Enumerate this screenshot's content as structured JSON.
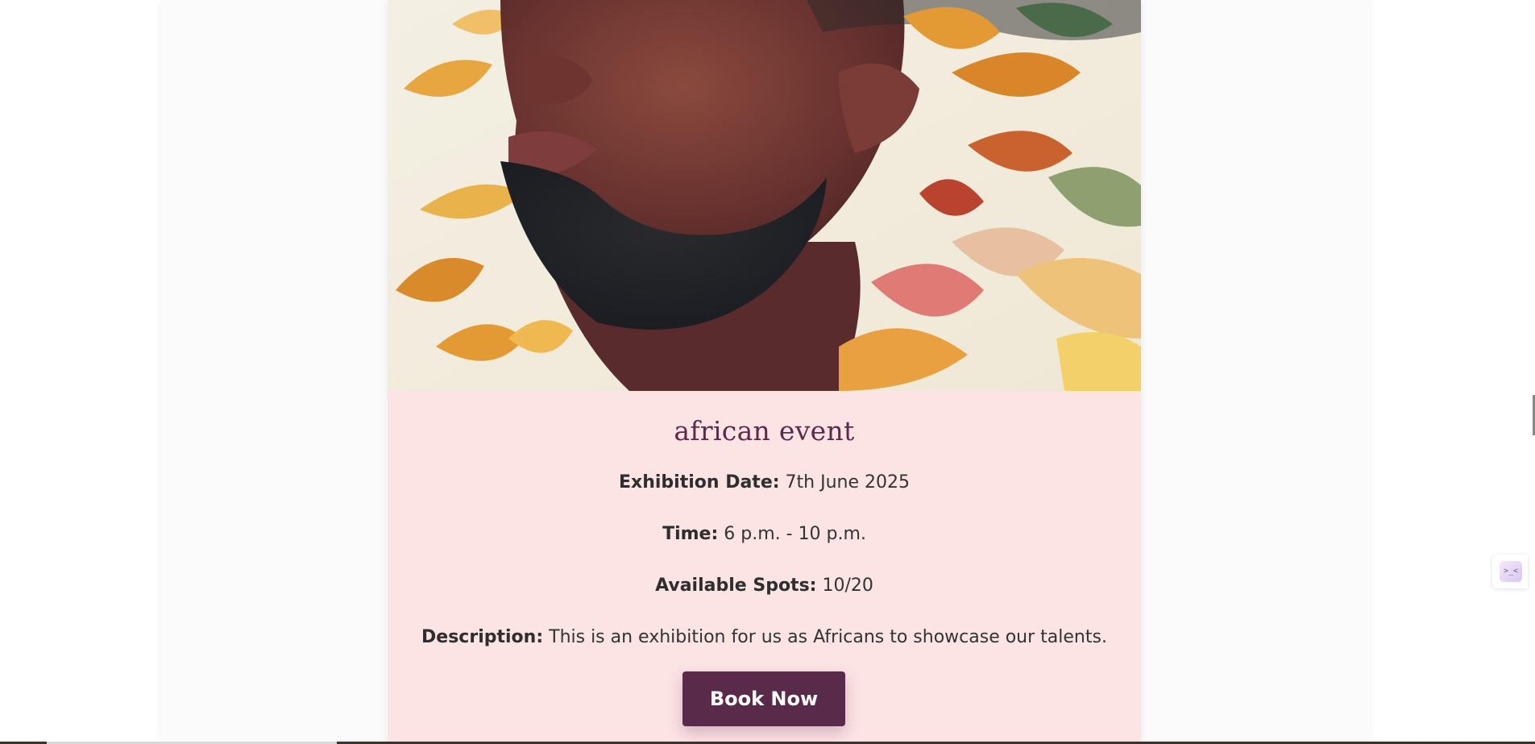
{
  "event": {
    "title": "african event",
    "image_alt": "Portrait of a man with leaves and flowers",
    "date_label": "Exhibition Date:",
    "date_value": "7th June 2025",
    "time_label": "Time:",
    "time_value": "6 p.m. - 10 p.m.",
    "spots_label": "Available Spots:",
    "spots_value": "10/20",
    "description_label": "Description:",
    "description_value": "This is an exhibition for us as Africans to showcase our talents.",
    "book_label": "Book Now"
  },
  "widget": {
    "glyph": ">_<"
  },
  "colors": {
    "card_background": "#fce3e4",
    "title": "#5c2a4a",
    "button": "#5a2a4a"
  }
}
